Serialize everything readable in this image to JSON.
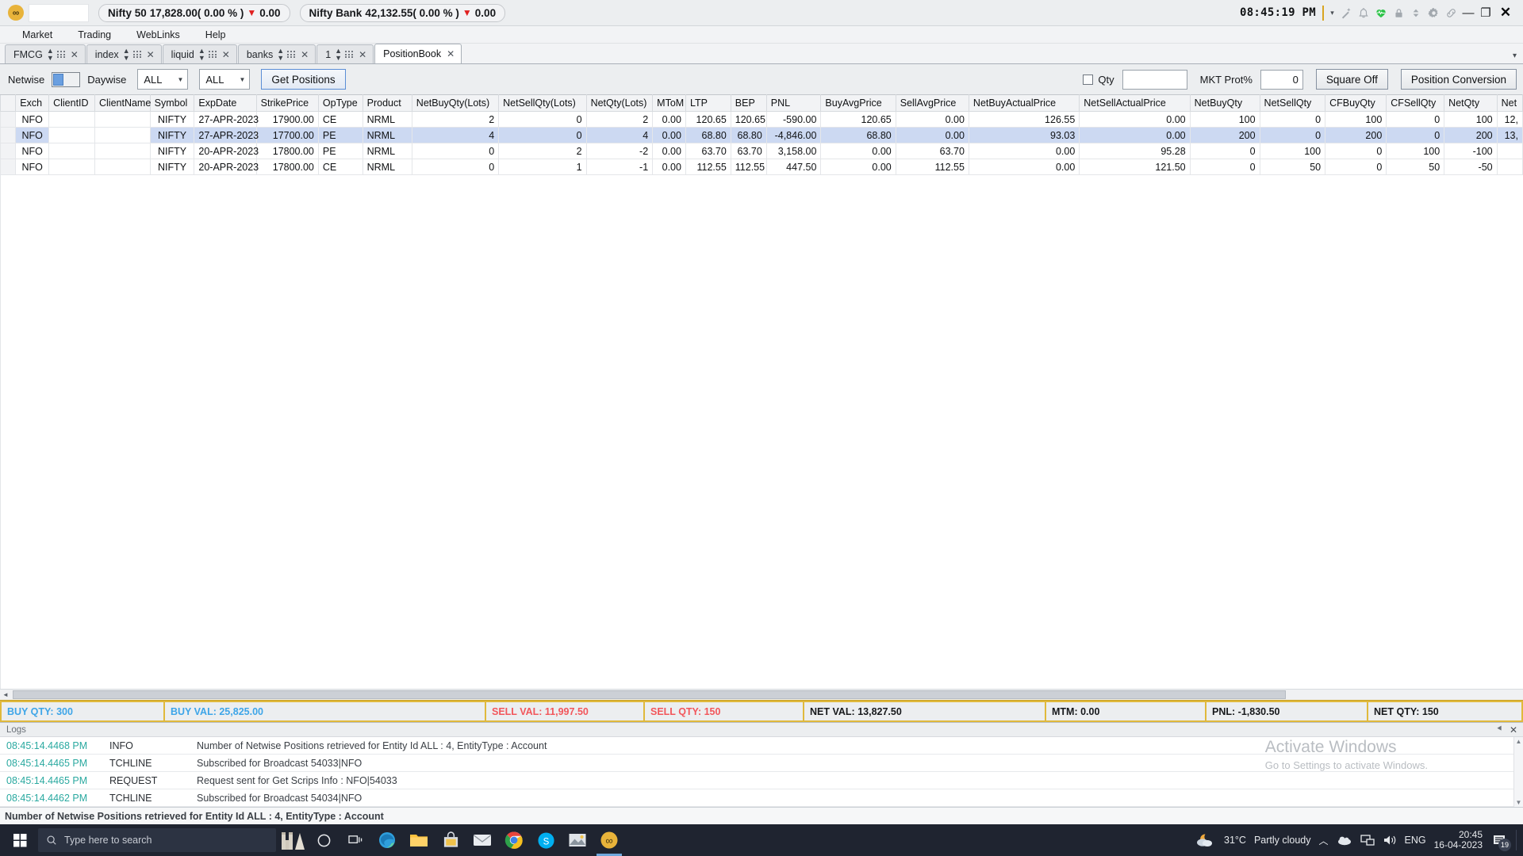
{
  "titlebar": {
    "logo": "infinity-logo",
    "tickers": [
      {
        "name": "Nifty 50",
        "value": "17,828.00( 0.00 % )",
        "arrow": "▼",
        "change": "0.00"
      },
      {
        "name": "Nifty Bank",
        "value": "42,132.55( 0.00 % )",
        "arrow": "▼",
        "change": "0.00"
      }
    ],
    "clock": "08:45:19 PM",
    "icons": [
      "caret-down-icon",
      "magic-wand-icon",
      "bell-icon",
      "heartbeat-icon",
      "lock-icon",
      "sort-updown-icon",
      "gear-icon",
      "link-icon"
    ],
    "window_buttons": {
      "minimize": "—",
      "restore": "❐",
      "close": "✕"
    }
  },
  "menubar": {
    "items": [
      "Market",
      "Trading",
      "WebLinks",
      "Help"
    ]
  },
  "tabs": {
    "items": [
      {
        "label": "FMCG",
        "active": false
      },
      {
        "label": "index",
        "active": false
      },
      {
        "label": "liquid",
        "active": false
      },
      {
        "label": "banks",
        "active": false
      },
      {
        "label": "1",
        "active": false
      },
      {
        "label": "PositionBook",
        "active": true
      }
    ],
    "overflow_caret": "▾"
  },
  "toolbar": {
    "netwise_label": "Netwise",
    "daywise_label": "Daywise",
    "select1": "ALL",
    "select2": "ALL",
    "get_positions": "Get Positions",
    "qty_checkbox_label": "Qty",
    "qty_value": "",
    "mkt_prot_label": "MKT Prot%",
    "mkt_prot_value": "0",
    "square_off": "Square Off",
    "position_conversion": "Position Conversion"
  },
  "grid": {
    "columns": [
      "Exch",
      "ClientID",
      "ClientName",
      "Symbol",
      "ExpDate",
      "StrikePrice",
      "OpType",
      "Product",
      "NetBuyQty(Lots)",
      "NetSellQty(Lots)",
      "NetQty(Lots)",
      "MToM",
      "LTP",
      "BEP",
      "PNL",
      "BuyAvgPrice",
      "SellAvgPrice",
      "NetBuyActualPrice",
      "NetSellActualPrice",
      "NetBuyQty",
      "NetSellQty",
      "CFBuyQty",
      "CFSellQty",
      "NetQty",
      "Net"
    ],
    "rows": [
      {
        "selected": false,
        "cells": [
          "NFO",
          "",
          "",
          "NIFTY",
          "27-APR-2023",
          "17900.00",
          "CE",
          "NRML",
          "2",
          "0",
          "2",
          "0.00",
          "120.65",
          "120.65",
          "-590.00",
          "120.65",
          "0.00",
          "126.55",
          "0.00",
          "100",
          "0",
          "100",
          "0",
          "100",
          "12,"
        ]
      },
      {
        "selected": true,
        "cells": [
          "NFO",
          "",
          "",
          "NIFTY",
          "27-APR-2023",
          "17700.00",
          "PE",
          "NRML",
          "4",
          "0",
          "4",
          "0.00",
          "68.80",
          "68.80",
          "-4,846.00",
          "68.80",
          "0.00",
          "93.03",
          "0.00",
          "200",
          "0",
          "200",
          "0",
          "200",
          "13,"
        ]
      },
      {
        "selected": false,
        "cells": [
          "NFO",
          "",
          "",
          "NIFTY",
          "20-APR-2023",
          "17800.00",
          "PE",
          "NRML",
          "0",
          "2",
          "-2",
          "0.00",
          "63.70",
          "63.70",
          "3,158.00",
          "0.00",
          "63.70",
          "0.00",
          "95.28",
          "0",
          "100",
          "0",
          "100",
          "-100",
          ""
        ]
      },
      {
        "selected": false,
        "cells": [
          "NFO",
          "",
          "",
          "NIFTY",
          "20-APR-2023",
          "17800.00",
          "CE",
          "NRML",
          "0",
          "1",
          "-1",
          "0.00",
          "112.55",
          "112.55",
          "447.50",
          "0.00",
          "112.55",
          "0.00",
          "121.50",
          "0",
          "50",
          "0",
          "50",
          "-50",
          ""
        ]
      }
    ]
  },
  "summary": [
    {
      "label": "BUY QTY:",
      "value": "300",
      "color": "buy"
    },
    {
      "label": "BUY VAL:",
      "value": "25,825.00",
      "color": "buy"
    },
    {
      "label": "SELL VAL:",
      "value": "11,997.50",
      "color": "sell"
    },
    {
      "label": "SELL QTY:",
      "value": "150",
      "color": "sell"
    },
    {
      "label": "NET VAL:",
      "value": "13,827.50",
      "color": "net"
    },
    {
      "label": "MTM:",
      "value": "0.00",
      "color": "net"
    },
    {
      "label": "PNL:",
      "value": "-1,830.50",
      "color": "net"
    },
    {
      "label": "NET QTY:",
      "value": "150",
      "color": "net"
    }
  ],
  "logs": {
    "title": "Logs",
    "pin_icon": "pin-icon",
    "close_icon": "close-icon",
    "entries": [
      {
        "time": "08:45:14.4468 PM",
        "type": "INFO",
        "message": "Number of Netwise Positions retrieved for Entity Id ALL : 4, EntityType : Account"
      },
      {
        "time": "08:45:14.4465 PM",
        "type": "TCHLINE",
        "message": "Subscribed for Broadcast 54033|NFO"
      },
      {
        "time": "08:45:14.4465 PM",
        "type": "REQUEST",
        "message": "Request sent for Get Scrips Info : NFO|54033"
      },
      {
        "time": "08:45:14.4462 PM",
        "type": "TCHLINE",
        "message": "Subscribed for Broadcast 54034|NFO"
      }
    ],
    "watermark_line1": "Activate Windows",
    "watermark_line2": "Go to Settings to activate Windows."
  },
  "statusbar": {
    "text": "Number of Netwise Positions retrieved for Entity Id ALL : 4, EntityType : Account"
  },
  "taskbar": {
    "search_placeholder": "Type here to search",
    "weather": {
      "temp": "31°C",
      "condition": "Partly cloudy"
    },
    "language": "ENG",
    "clock_time": "20:45",
    "clock_date": "16-04-2023",
    "notification_count": "19"
  },
  "colors": {
    "buy": "#3da5e8",
    "sell": "#f2565b",
    "net": "#16181b",
    "summary_border": "#e0b93c",
    "selected_row": "#ccd9f2",
    "log_time": "#2aa9a0",
    "down_arrow": "#e02020"
  }
}
